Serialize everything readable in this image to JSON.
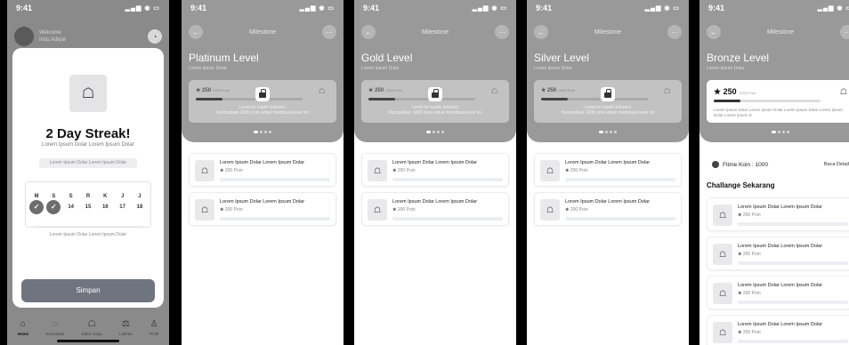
{
  "status": {
    "time": "9:41"
  },
  "home": {
    "welcome": "Welcome",
    "username": "Imtu Adiyar",
    "modal": {
      "title": "2 Day Streak!",
      "subtitle": "Lorem Ipsum Dolar Lorem Ipsum Dolar",
      "pill": "Lorem Ipsum Dolar Lorem Ipsum Dolar",
      "days": [
        "M",
        "S",
        "S",
        "R",
        "K",
        "J",
        "J"
      ],
      "dates": [
        "✓",
        "✓",
        "14",
        "15",
        "16",
        "17",
        "18"
      ],
      "footer": "Lorem Ipsum Dolar Lorem Ipsum Dolar",
      "button": "Simpan"
    },
    "tabs": [
      {
        "label": "Home",
        "icon": "home-icon"
      },
      {
        "label": "Konsultasi",
        "icon": "chat-icon"
      },
      {
        "label": "Kalori Saya",
        "icon": "food-icon"
      },
      {
        "label": "Latihan",
        "icon": "dumbbell-icon"
      },
      {
        "label": "Profil",
        "icon": "profile-icon"
      }
    ]
  },
  "milestone": {
    "nav_title": "Milestone",
    "subtitle": "Lorem Ipsum Dolar",
    "points": "250",
    "points_total": "/1000 Poin",
    "progress": 0.25,
    "locked_line1": "Level ini masih terkunci",
    "locked_line2": "Kumpulkan 1000 poin untuk membuka level ini",
    "challenge_title": "Lorem Ipsum Dolar Lorem Ipsum Dolar",
    "challenge_points": "200 Poin",
    "levels": [
      {
        "name": "Platinum Level"
      },
      {
        "name": "Gold Level"
      },
      {
        "name": "Silver Level"
      }
    ],
    "bronze": {
      "name": "Bronze Level",
      "description": "Lorem Ipsum Dolar Lorem Ipsum Dolar Lorem Ipsum Dolar Lorem Ipsum Dolar Lorem Ipsum D",
      "koin": "Fitme Koin : 1000",
      "detail_link": "Baca Detail",
      "section": "Challange Sekarang"
    }
  }
}
